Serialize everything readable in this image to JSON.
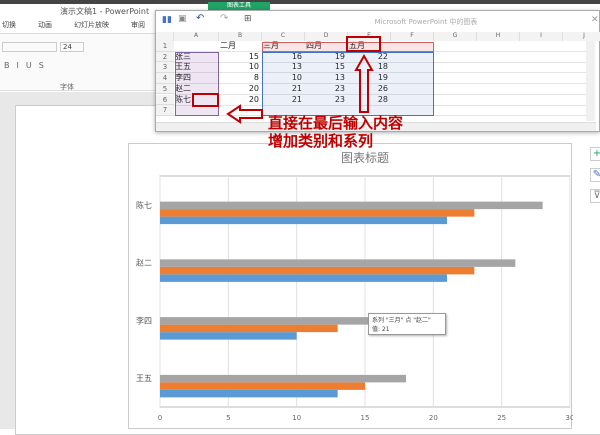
{
  "app": {
    "title": "演示文稿1 - PowerPoint",
    "tool_tab": "图表工具",
    "ribbon_tabs": [
      "切换",
      "动画",
      "幻灯片放映",
      "审阅",
      "视"
    ],
    "font_size": "24",
    "font_group_label": "字体"
  },
  "sheet": {
    "title": "Microsoft PowerPoint 中的图表",
    "columns": [
      "A",
      "B",
      "C",
      "D",
      "E",
      "F",
      "G",
      "H",
      "I",
      "J"
    ],
    "rows": [
      [
        "",
        "二月",
        "三月",
        "四月",
        "五月"
      ],
      [
        "张三",
        "15",
        "16",
        "19",
        "22"
      ],
      [
        "王五",
        "10",
        "13",
        "15",
        "18"
      ],
      [
        "李四",
        "8",
        "10",
        "13",
        "19"
      ],
      [
        "赵二",
        "20",
        "21",
        "23",
        "26"
      ],
      [
        "陈七",
        "20",
        "21",
        "23",
        "28"
      ],
      [
        "",
        "",
        "",
        "",
        ""
      ]
    ]
  },
  "annotations": {
    "line1": "直接在最后输入内容",
    "line2": "增加类别和系列"
  },
  "tooltip": {
    "line1": "系列 \"三月\" 点 \"赵二\"",
    "line2": "值: 21"
  },
  "colors": {
    "s1": "#5b9bd5",
    "s2": "#ed7d31",
    "s3": "#a5a5a5",
    "annotation": "#c00000"
  },
  "chart_data": {
    "type": "bar",
    "orientation": "horizontal",
    "title": "图表标题",
    "categories": [
      "王五",
      "李四",
      "赵二",
      "陈七"
    ],
    "series": [
      {
        "name": "三月",
        "values": [
          13,
          10,
          21,
          21
        ]
      },
      {
        "name": "四月",
        "values": [
          15,
          13,
          23,
          23
        ]
      },
      {
        "name": "五月",
        "values": [
          18,
          19,
          26,
          28
        ]
      }
    ],
    "xlim": [
      0,
      30
    ],
    "xticks": [
      "0",
      "5",
      "10",
      "15",
      "20",
      "25",
      "30"
    ],
    "grid": true
  }
}
